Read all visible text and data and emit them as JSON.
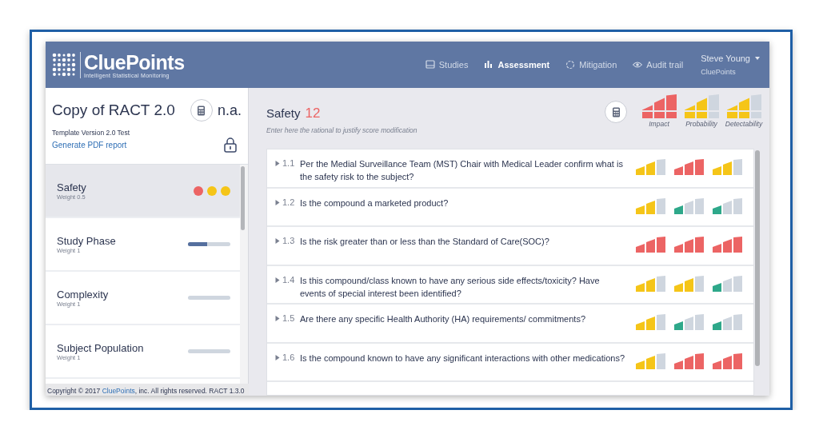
{
  "header": {
    "logo": "CluePoints",
    "tagline": "Intelligent Statistical Monitoring",
    "nav": [
      {
        "label": "Studies",
        "selected": false
      },
      {
        "label": "Assessment",
        "selected": true
      },
      {
        "label": "Mitigation",
        "selected": false
      },
      {
        "label": "Audit trail",
        "selected": false
      }
    ],
    "user": {
      "name": "Steve Young",
      "org": "CluePoints"
    }
  },
  "sidebar": {
    "title": "Copy of RACT 2.0",
    "score": "n.a.",
    "template": "Template Version 2.0 Test",
    "pdf_link": "Generate PDF report",
    "items": [
      {
        "label": "Safety",
        "weight": "Weight 0.5",
        "selected": true,
        "kind": "dots",
        "dots": [
          {
            "color": "#ec6464"
          },
          {
            "color": "#f5c518"
          },
          {
            "color": "#f5c518"
          }
        ]
      },
      {
        "label": "Study Phase",
        "weight": "Weight 1",
        "selected": false,
        "kind": "bar",
        "level": 0.45
      },
      {
        "label": "Complexity",
        "weight": "Weight 1",
        "selected": false,
        "kind": "bar",
        "level": 0
      },
      {
        "label": "Subject Population",
        "weight": "Weight 1",
        "selected": false,
        "kind": "bar",
        "level": 0
      }
    ]
  },
  "section": {
    "title": "Safety",
    "score": "12",
    "rationale": {
      "placeholder": "Enter here the rational to justify score modification"
    },
    "meters": [
      {
        "label": "Impact",
        "level": 1,
        "color": "#ec6464"
      },
      {
        "label": "Probability",
        "level": 0.67,
        "color": "#f5c518"
      },
      {
        "label": "Detectability",
        "level": 0.67,
        "color": "#f5c518"
      }
    ],
    "questions": [
      {
        "number": "1.1",
        "text": "Per the Medial Surveillance Team (MST) Chair with Medical Leader confirm what is the safety risk to the subject?",
        "ratings": [
          {
            "level": 0.67,
            "color": "#f5c518"
          },
          {
            "level": 1,
            "color": "#ec6464"
          },
          {
            "level": 0.67,
            "color": "#f5c518"
          }
        ]
      },
      {
        "number": "1.2",
        "text": "Is the compound a marketed product?",
        "ratings": [
          {
            "level": 0.67,
            "color": "#f5c518"
          },
          {
            "level": 0.33,
            "color": "#2ea88a"
          },
          {
            "level": 0.33,
            "color": "#2ea88a"
          }
        ]
      },
      {
        "number": "1.3",
        "text": "Is the risk greater than or less than the Standard of Care(SOC)?",
        "ratings": [
          {
            "level": 1,
            "color": "#ec6464"
          },
          {
            "level": 1,
            "color": "#ec6464"
          },
          {
            "level": 1,
            "color": "#ec6464"
          }
        ]
      },
      {
        "number": "1.4",
        "text": "Is this compound/class known to have any serious side effects/toxicity? Have events of special interest been identified?",
        "ratings": [
          {
            "level": 0.67,
            "color": "#f5c518"
          },
          {
            "level": 0.67,
            "color": "#f5c518"
          },
          {
            "level": 0.33,
            "color": "#2ea88a"
          }
        ]
      },
      {
        "number": "1.5",
        "text": "Are there any specific Health Authority (HA) requirements/ commitments?",
        "ratings": [
          {
            "level": 0.67,
            "color": "#f5c518"
          },
          {
            "level": 0.33,
            "color": "#2ea88a"
          },
          {
            "level": 0.33,
            "color": "#2ea88a"
          }
        ]
      },
      {
        "number": "1.6",
        "text": "Is the compound known to have any significant interactions with other medications?",
        "ratings": [
          {
            "level": 0.67,
            "color": "#f5c518"
          },
          {
            "level": 1,
            "color": "#ec6464"
          },
          {
            "level": 1,
            "color": "#ec6464"
          }
        ]
      }
    ]
  },
  "footer": {
    "before": "Copyright  © 2017 ",
    "link": "CluePoints",
    "after": ", inc. All rights reserved. RACT 1.3.0"
  }
}
